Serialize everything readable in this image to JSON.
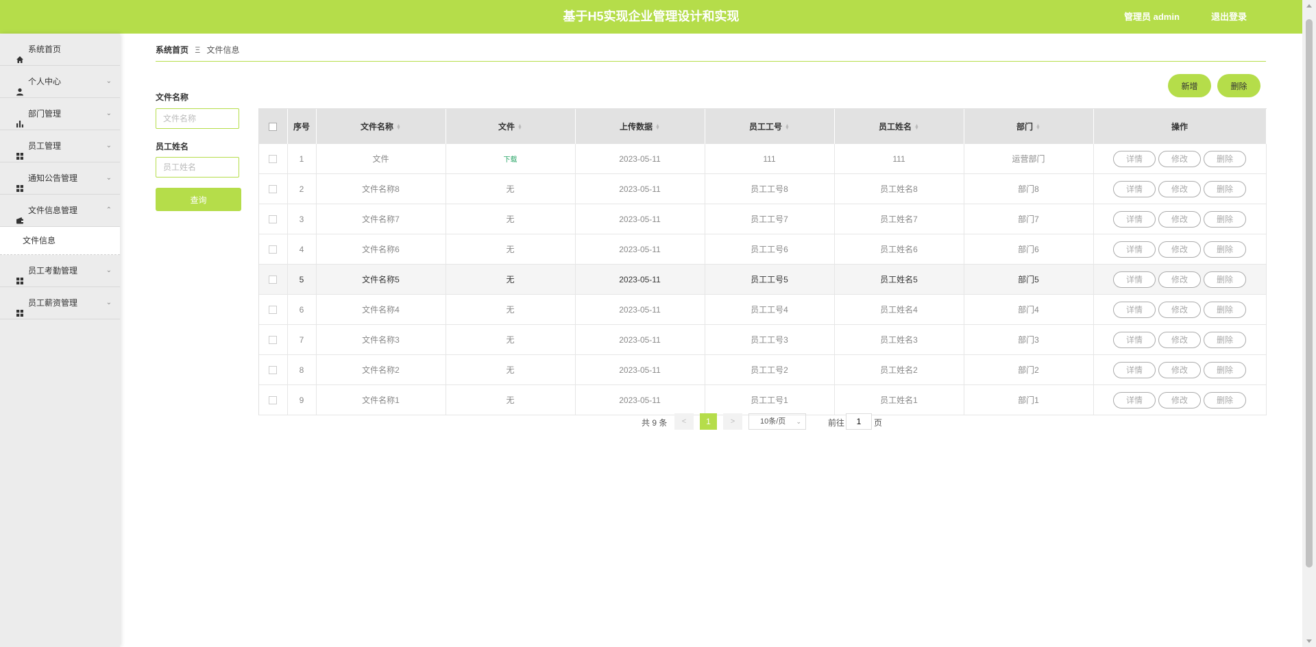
{
  "header": {
    "title": "基于H5实现企业管理设计和实现",
    "user": "管理员 admin",
    "logout": "退出登录"
  },
  "sidebar": {
    "items": [
      {
        "label": "系统首页",
        "icon": "home-icon",
        "chevron": ""
      },
      {
        "label": "个人中心",
        "icon": "user-icon",
        "chevron": "⌄"
      },
      {
        "label": "部门管理",
        "icon": "bar-chart-icon",
        "chevron": "⌄"
      },
      {
        "label": "员工管理",
        "icon": "grid-icon",
        "chevron": "⌄"
      },
      {
        "label": "通知公告管理",
        "icon": "grid-icon",
        "chevron": "⌄"
      },
      {
        "label": "文件信息管理",
        "icon": "wallet-icon",
        "chevron": "⌃"
      }
    ],
    "submenu": [
      {
        "label": "文件信息"
      }
    ],
    "items_after": [
      {
        "label": "员工考勤管理",
        "icon": "grid-icon",
        "chevron": "⌄"
      },
      {
        "label": "员工薪资管理",
        "icon": "grid-icon",
        "chevron": "⌄"
      }
    ]
  },
  "breadcrumb": {
    "home": "系统首页",
    "separator": "Ξ",
    "current": "文件信息"
  },
  "search": {
    "filename_label": "文件名称",
    "filename_placeholder": "文件名称",
    "staffname_label": "员工姓名",
    "staffname_placeholder": "员工姓名",
    "query_button": "查询"
  },
  "actions": {
    "add": "新增",
    "delete": "删除"
  },
  "table": {
    "columns": [
      "序号",
      "文件名称",
      "文件",
      "上传数据",
      "员工工号",
      "员工姓名",
      "部门",
      "操作"
    ],
    "rows": [
      [
        "1",
        "文件",
        "下载",
        "2023-05-11",
        "111",
        "111",
        "运营部门"
      ],
      [
        "2",
        "文件名称8",
        "无",
        "2023-05-11",
        "员工工号8",
        "员工姓名8",
        "部门8"
      ],
      [
        "3",
        "文件名称7",
        "无",
        "2023-05-11",
        "员工工号7",
        "员工姓名7",
        "部门7"
      ],
      [
        "4",
        "文件名称6",
        "无",
        "2023-05-11",
        "员工工号6",
        "员工姓名6",
        "部门6"
      ],
      [
        "5",
        "文件名称5",
        "无",
        "2023-05-11",
        "员工工号5",
        "员工姓名5",
        "部门5"
      ],
      [
        "6",
        "文件名称4",
        "无",
        "2023-05-11",
        "员工工号4",
        "员工姓名4",
        "部门4"
      ],
      [
        "7",
        "文件名称3",
        "无",
        "2023-05-11",
        "员工工号3",
        "员工姓名3",
        "部门3"
      ],
      [
        "8",
        "文件名称2",
        "无",
        "2023-05-11",
        "员工工号2",
        "员工姓名2",
        "部门2"
      ],
      [
        "9",
        "文件名称1",
        "无",
        "2023-05-11",
        "员工工号1",
        "员工姓名1",
        "部门1"
      ]
    ],
    "row_actions": [
      "详情",
      "修改",
      "删除"
    ],
    "highlighted_row": "5"
  },
  "pagination": {
    "total_text": "共 9 条",
    "prev": "<",
    "current_page": "1",
    "next": ">",
    "page_size": "10条/页",
    "goto_label": "前往",
    "goto_value": "1",
    "page_suffix": "页"
  },
  "colors": {
    "accent": "#b5dd4a",
    "download_link": "#2ba668"
  }
}
